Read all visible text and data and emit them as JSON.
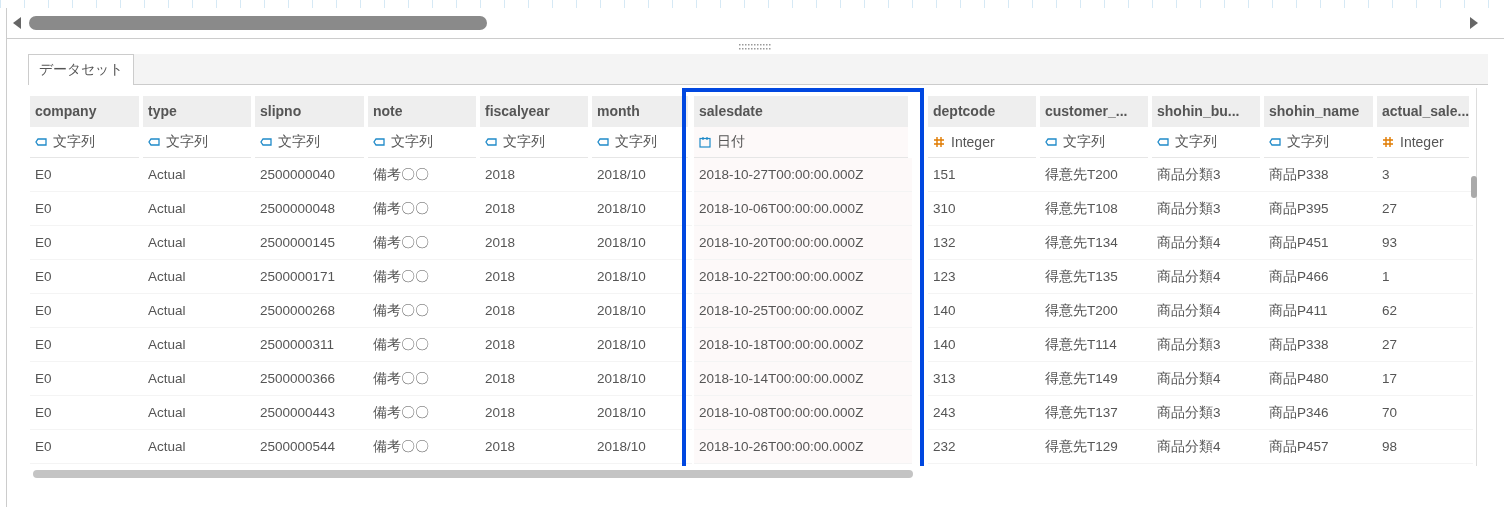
{
  "tabs": [
    {
      "label": "データセット",
      "selected": true
    }
  ],
  "table": {
    "columns": [
      {
        "name": "company",
        "type_label": "文字列",
        "kind": "string",
        "highlighted": false
      },
      {
        "name": "type",
        "type_label": "文字列",
        "kind": "string",
        "highlighted": false
      },
      {
        "name": "slipno",
        "type_label": "文字列",
        "kind": "string",
        "highlighted": false
      },
      {
        "name": "note",
        "type_label": "文字列",
        "kind": "string",
        "highlighted": false
      },
      {
        "name": "fiscalyear",
        "type_label": "文字列",
        "kind": "string",
        "highlighted": false
      },
      {
        "name": "month",
        "type_label": "文字列",
        "kind": "string",
        "highlighted": false
      },
      {
        "name": "salesdate",
        "type_label": "日付",
        "kind": "date",
        "highlighted": true
      },
      {
        "name": "deptcode",
        "type_label": "Integer",
        "kind": "integer",
        "highlighted": false
      },
      {
        "name": "customer_...",
        "type_label": "文字列",
        "kind": "string",
        "highlighted": false
      },
      {
        "name": "shohin_bu...",
        "type_label": "文字列",
        "kind": "string",
        "highlighted": false
      },
      {
        "name": "shohin_name",
        "type_label": "文字列",
        "kind": "string",
        "highlighted": false
      },
      {
        "name": "actual_sale...",
        "type_label": "Integer",
        "kind": "integer",
        "highlighted": false
      }
    ],
    "rows": [
      [
        "E0",
        "Actual",
        "2500000040",
        "備考〇〇",
        "2018",
        "2018/10",
        "2018-10-27T00:00:00.000Z",
        "151",
        "得意先T200",
        "商品分類3",
        "商品P338",
        "3"
      ],
      [
        "E0",
        "Actual",
        "2500000048",
        "備考〇〇",
        "2018",
        "2018/10",
        "2018-10-06T00:00:00.000Z",
        "310",
        "得意先T108",
        "商品分類3",
        "商品P395",
        "27"
      ],
      [
        "E0",
        "Actual",
        "2500000145",
        "備考〇〇",
        "2018",
        "2018/10",
        "2018-10-20T00:00:00.000Z",
        "132",
        "得意先T134",
        "商品分類4",
        "商品P451",
        "93"
      ],
      [
        "E0",
        "Actual",
        "2500000171",
        "備考〇〇",
        "2018",
        "2018/10",
        "2018-10-22T00:00:00.000Z",
        "123",
        "得意先T135",
        "商品分類4",
        "商品P466",
        "1"
      ],
      [
        "E0",
        "Actual",
        "2500000268",
        "備考〇〇",
        "2018",
        "2018/10",
        "2018-10-25T00:00:00.000Z",
        "140",
        "得意先T200",
        "商品分類4",
        "商品P411",
        "62"
      ],
      [
        "E0",
        "Actual",
        "2500000311",
        "備考〇〇",
        "2018",
        "2018/10",
        "2018-10-18T00:00:00.000Z",
        "140",
        "得意先T114",
        "商品分類3",
        "商品P338",
        "27"
      ],
      [
        "E0",
        "Actual",
        "2500000366",
        "備考〇〇",
        "2018",
        "2018/10",
        "2018-10-14T00:00:00.000Z",
        "313",
        "得意先T149",
        "商品分類4",
        "商品P480",
        "17"
      ],
      [
        "E0",
        "Actual",
        "2500000443",
        "備考〇〇",
        "2018",
        "2018/10",
        "2018-10-08T00:00:00.000Z",
        "243",
        "得意先T137",
        "商品分類3",
        "商品P346",
        "70"
      ],
      [
        "E0",
        "Actual",
        "2500000544",
        "備考〇〇",
        "2018",
        "2018/10",
        "2018-10-26T00:00:00.000Z",
        "232",
        "得意先T129",
        "商品分類4",
        "商品P457",
        "98"
      ]
    ]
  }
}
